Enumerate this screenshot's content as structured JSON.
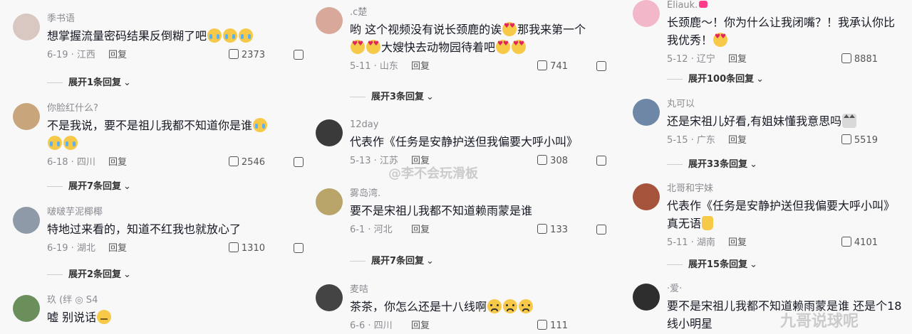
{
  "columns": [
    [
      {
        "user": "季书语",
        "text": "想掌握流量密码结果反倒糊了吧",
        "emoji": [
          "cry",
          "cry",
          "cry"
        ],
        "date": "6-19",
        "region": "江西",
        "reply": "回复",
        "likes": "2373",
        "expand": "展开1条回复",
        "avatar_color": "#d9c7c1"
      },
      {
        "user": "你脸红什么?",
        "text": "不是我说，要不是祖儿我都不知道你是谁",
        "emoji": [
          "cry",
          "cry",
          "cry"
        ],
        "date": "6-18",
        "region": "四川",
        "reply": "回复",
        "likes": "2546",
        "expand": "展开7条回复",
        "avatar_color": "#c8a57a"
      },
      {
        "user": "啵啵芋泥椰椰",
        "text": "特地过来看的，知道不红我也就放心了",
        "emoji": [],
        "date": "6-19",
        "region": "湖北",
        "reply": "回复",
        "likes": "1310",
        "expand": "展开2条回复",
        "avatar_color": "#8f9aa8"
      },
      {
        "user": "玖 (绊 ◎ S4",
        "text": "嘘 别说话",
        "emoji": [
          "think"
        ],
        "date": "",
        "region": "",
        "reply": "",
        "likes": "",
        "expand": "",
        "avatar_color": "#6b8f5a"
      }
    ],
    [
      {
        "user": ".c楚",
        "text": "哟 这个视频没有说长颈鹿的诶",
        "emoji": [
          "heart"
        ],
        "text2": "那我来第一个",
        "emoji2": [
          "heart",
          "heart"
        ],
        "text3": "大嫂快去动物园待着吧",
        "emoji3": [
          "heart",
          "heart"
        ],
        "date": "5-11",
        "region": "山东",
        "reply": "回复",
        "likes": "741",
        "expand": "展开3条回复",
        "avatar_color": "#d8a99a"
      },
      {
        "user": "12day",
        "text": "代表作《任务是安静护送但我偏要大呼小叫》",
        "emoji": [],
        "date": "5-13",
        "region": "江苏",
        "reply": "回复",
        "likes": "308",
        "expand": "",
        "avatar_color": "#3a3a3a"
      },
      {
        "user": "雾岛湾.",
        "text": "要不是宋祖儿我都不知道赖雨蒙是谁",
        "emoji": [],
        "date": "6-1",
        "region": "河北",
        "reply": "回复",
        "likes": "133",
        "expand": "展开7条回复",
        "avatar_color": "#b9a46a"
      },
      {
        "user": "麦咭",
        "text": "茶茶，你怎么还是十八线啊",
        "emoji": [
          "sad",
          "sad",
          "sad"
        ],
        "date": "6-6",
        "region": "四川",
        "reply": "回复",
        "likes": "111",
        "expand": "",
        "avatar_color": "#444444"
      }
    ],
    [
      {
        "user": "Eliauk.",
        "text": "长颈鹿～！你为什么让我闭嘴？！我承认你比",
        "text2": "我优秀！",
        "emoji2": [
          "heart"
        ],
        "date": "5-12",
        "region": "辽宁",
        "reply": "回复",
        "likes": "8881",
        "expand": "展开100条回复",
        "avatar_color": "#f2b7c9"
      },
      {
        "user": "丸可以",
        "text": "还是宋祖儿好看,有姐妹懂我意思吗",
        "emoji": [
          "cat"
        ],
        "date": "5-15",
        "region": "广东",
        "reply": "回复",
        "likes": "5519",
        "expand": "展开33条回复",
        "avatar_color": "#6f87a6"
      },
      {
        "user": "北哥和宇妹",
        "text": "代表作《任务是安静护送但我偏要大呼小叫》",
        "text2": "真无语",
        "emoji2": [
          "thumb"
        ],
        "date": "5-11",
        "region": "湖南",
        "reply": "回复",
        "likes": "4101",
        "expand": "展开15条回复",
        "avatar_color": "#a5533a"
      },
      {
        "user": "·爱·",
        "text": "要不是宋祖儿我都不知道赖雨蒙是谁 还是个18",
        "text2": "线小明星",
        "date": "",
        "region": "",
        "reply": "",
        "likes": "",
        "expand": "",
        "avatar_color": "#2e2e2e"
      }
    ]
  ],
  "watermarks": {
    "center": "@李不会玩滑板",
    "bottom_right": "九哥说球呢"
  }
}
